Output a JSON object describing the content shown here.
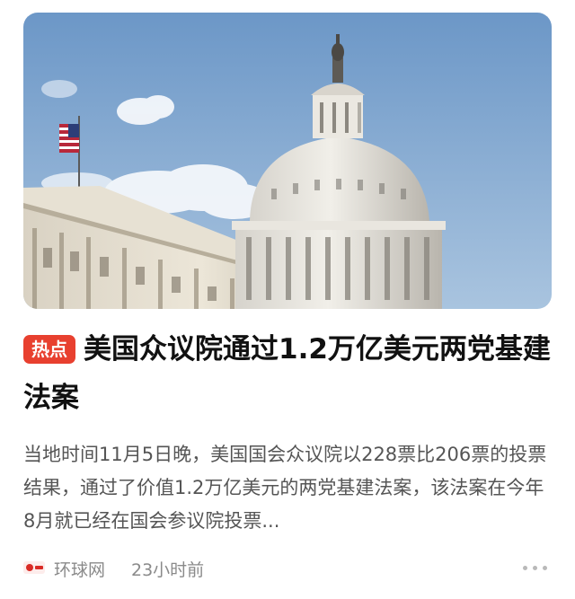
{
  "article": {
    "tag": "热点",
    "title": "美国众议院通过1.2万亿美元两党基建法案",
    "summary": "当地时间11月5日晚，美国国会众议院以228票比206票的投票结果，通过了价值1.2万亿美元的两党基建法案，该法案在今年8月就已经在国会参议院投票...",
    "source": "环球网",
    "time": "23小时前"
  },
  "icons": {
    "source_logo": "huanqiu-logo-icon",
    "more": "more-dots-icon"
  },
  "colors": {
    "tag_bg": "#e8402f",
    "title": "#111111",
    "summary": "#555555",
    "meta": "#8a8a8a"
  }
}
